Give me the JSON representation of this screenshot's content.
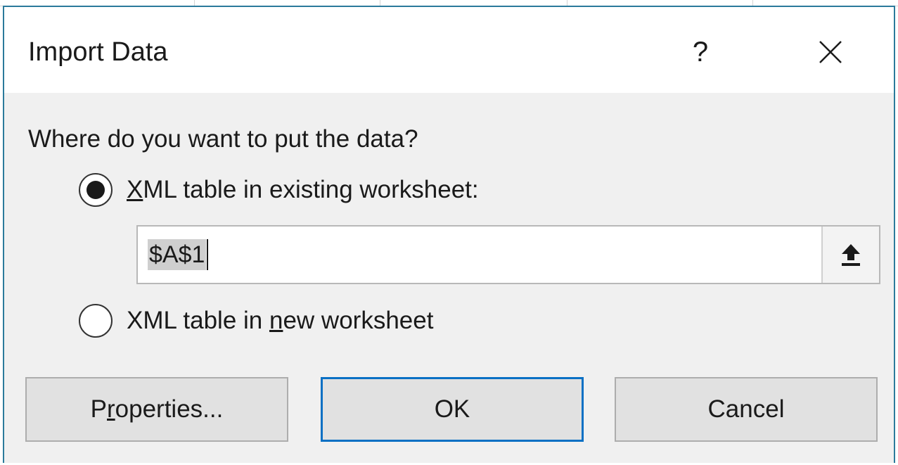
{
  "dialog": {
    "title": "Import Data",
    "help_label": "?",
    "close_label": "✕",
    "prompt": "Where do you want to put the data?",
    "options": {
      "existing": {
        "before": "",
        "mnemonic": "X",
        "after": "ML table in existing worksheet:",
        "selected": true
      },
      "new": {
        "before": "XML table in ",
        "mnemonic": "n",
        "after": "ew worksheet",
        "selected": false
      }
    },
    "location": {
      "value": "$A$1"
    },
    "buttons": {
      "properties": {
        "before": "P",
        "mnemonic": "r",
        "after": "operties..."
      },
      "ok": "OK",
      "cancel": "Cancel"
    }
  },
  "icons": {
    "help": "question-mark-icon",
    "close": "close-x-icon",
    "collapse": "collapse-dialog-icon"
  },
  "colors": {
    "accent": "#0a70c4",
    "frame": "#2b7a9b",
    "dialog_bg": "#f0f0f0",
    "button_bg": "#e1e1e1"
  }
}
